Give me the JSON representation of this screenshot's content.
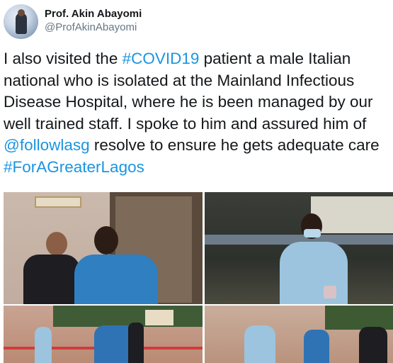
{
  "author": {
    "display_name": "Prof. Akin Abayomi",
    "handle": "@ProfAkinAbayomi"
  },
  "tweet": {
    "part1": "I also visited the ",
    "hashtag1": "#COVID19",
    "part2": " patient a male Italian national who is isolated at the Mainland Infectious Disease Hospital, where he is been managed by our well trained staff. I spoke to him and assured  him of ",
    "mention": "@followlasg",
    "part3": " resolve to ensure he gets adequate care ",
    "hashtag2": "#ForAGreaterLagos"
  },
  "colors": {
    "link": "#1b95e0",
    "text": "#14171a",
    "secondary": "#657786"
  },
  "icons": [
    "profile-avatar"
  ]
}
